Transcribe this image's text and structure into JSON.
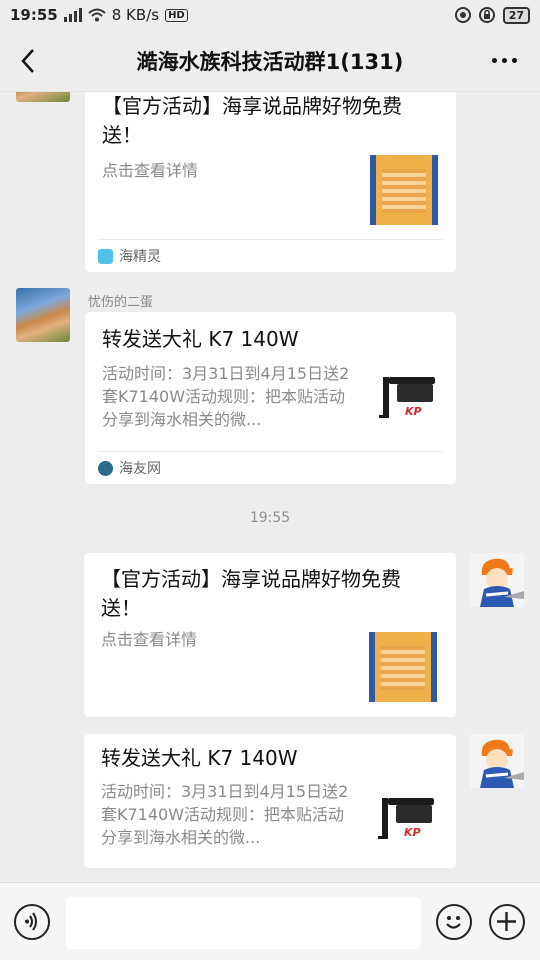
{
  "status_bar": {
    "time": "19:55",
    "network_speed": "8 KB/s",
    "hd_label": "HD",
    "battery": "27"
  },
  "header": {
    "title": "澔海水族科技活动群1(131)"
  },
  "messages": [
    {
      "title": "【官方活动】海享说品牌好物免费送！",
      "description": "点击查看详情",
      "source": "海精灵",
      "thumb": "blurred-poster"
    },
    {
      "sender": "忧伤的二蛋",
      "title": "转发送大礼 K7 140W",
      "description": "活动时间：3月31日到4月15日送2套K7140W活动规则：把本贴活动分享到海水相关的微...",
      "source": "海友网",
      "thumb": "lamp",
      "thumb_brand": "KP"
    },
    {
      "timestamp": "19:55"
    },
    {
      "title": "【官方活动】海享说品牌好物免费送！",
      "description": "点击查看详情",
      "thumb": "blurred-poster"
    },
    {
      "title": "转发送大礼 K7 140W",
      "description": "活动时间：3月31日到4月15日送2套K7140W活动规则：把本贴活动分享到海水相关的微...",
      "thumb": "lamp",
      "thumb_brand": "KP"
    }
  ],
  "input": {
    "value": ""
  },
  "icons": {
    "back": "back-arrow-icon",
    "more": "more-dots-icon",
    "voice": "voice-icon",
    "emoji": "emoji-icon",
    "plus": "plus-icon"
  },
  "colors": {
    "background": "#ededed",
    "card": "#ffffff",
    "secondary_text": "#8a8a8a"
  }
}
